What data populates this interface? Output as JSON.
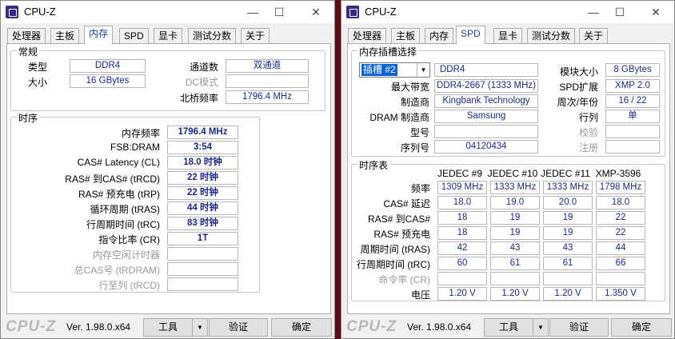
{
  "left_window": {
    "title": "CPU-Z",
    "tabs": [
      "处理器",
      "主板",
      "内存",
      "SPD",
      "显卡",
      "测试分数",
      "关于"
    ],
    "general": {
      "title": "常规",
      "type_label": "类型",
      "type_value": "DDR4",
      "size_label": "大小",
      "size_value": "16 GBytes",
      "channels_label": "通道数",
      "channels_value": "双通道",
      "dc_mode_label": "DC模式",
      "dc_mode_value": "",
      "nb_freq_label": "北桥频率",
      "nb_freq_value": "1796.4 MHz"
    },
    "timings": {
      "title": "时序",
      "rows": [
        {
          "label": "内存频率",
          "value": "1796.4 MHz",
          "dim": false
        },
        {
          "label": "FSB:DRAM",
          "value": "3:54",
          "dim": false
        },
        {
          "label": "CAS# Latency (CL)",
          "value": "18.0 时钟",
          "dim": false
        },
        {
          "label": "RAS# 到CAS# (tRCD)",
          "value": "22 时钟",
          "dim": false
        },
        {
          "label": "RAS# 预充电 (tRP)",
          "value": "22 时钟",
          "dim": false
        },
        {
          "label": "循环周期 (tRAS)",
          "value": "44 时钟",
          "dim": false
        },
        {
          "label": "行周期时间 (tRC)",
          "value": "83 时钟",
          "dim": false
        },
        {
          "label": "指令比率 (CR)",
          "value": "1T",
          "dim": false
        },
        {
          "label": "内存空闲计时器",
          "value": "",
          "dim": true
        },
        {
          "label": "总CAS号 (tRDRAM)",
          "value": "",
          "dim": true
        },
        {
          "label": "行至列 (tRCD)",
          "value": "",
          "dim": true
        }
      ]
    },
    "footer": {
      "logo": "CPU-Z",
      "version": "Ver. 1.98.0.x64",
      "tools": "工具",
      "validate": "验证",
      "ok": "确定"
    }
  },
  "right_window": {
    "title": "CPU-Z",
    "tabs": [
      "处理器",
      "主板",
      "内存",
      "SPD",
      "显卡",
      "测试分数",
      "关于"
    ],
    "slot": {
      "title": "内存插槽选择",
      "selected_slot": "插槽 #2",
      "type_value": "DDR4",
      "module_size_label": "模块大小",
      "module_size_value": "8 GBytes",
      "max_bw_label": "最大带宽",
      "max_bw_value": "DDR4-2667 (1333 MHz)",
      "spd_ext_label": "SPD扩展",
      "spd_ext_value": "XMP 2.0",
      "manufacturer_label": "制造商",
      "manufacturer_value": "Kingbank Technology",
      "week_year_label": "周次/年份",
      "week_year_value": "16 / 22",
      "dram_mfr_label": "DRAM 制造商",
      "dram_mfr_value": "Samsung",
      "ranks_label": "行列",
      "ranks_value": "单",
      "part_label": "型号",
      "part_value": "",
      "verify_label": "校验",
      "verify_value": "",
      "serial_label": "序列号",
      "serial_value": "04120434",
      "registered_label": "注册",
      "registered_value": ""
    },
    "timing_table": {
      "title": "时序表",
      "columns": [
        "JEDEC #9",
        "JEDEC #10",
        "JEDEC #11",
        "XMP-3596"
      ],
      "rows": [
        {
          "label": "频率",
          "values": [
            "1309 MHz",
            "1333 MHz",
            "1333 MHz",
            "1798 MHz"
          ],
          "dim": false
        },
        {
          "label": "CAS# 延迟",
          "values": [
            "18.0",
            "19.0",
            "20.0",
            "18.0"
          ],
          "dim": false
        },
        {
          "label": "RAS# 到CAS#",
          "values": [
            "18",
            "19",
            "19",
            "22"
          ],
          "dim": false
        },
        {
          "label": "RAS# 预充电",
          "values": [
            "18",
            "19",
            "19",
            "22"
          ],
          "dim": false
        },
        {
          "label": "周期时间 (tRAS)",
          "values": [
            "42",
            "43",
            "43",
            "44"
          ],
          "dim": false
        },
        {
          "label": "行周期时间 (tRC)",
          "values": [
            "60",
            "61",
            "61",
            "66"
          ],
          "dim": false
        },
        {
          "label": "命令率 (CR)",
          "values": [
            "",
            "",
            "",
            ""
          ],
          "dim": true
        },
        {
          "label": "电压",
          "values": [
            "1.20 V",
            "1.20 V",
            "1.20 V",
            "1.350 V"
          ],
          "dim": false
        }
      ]
    },
    "footer": {
      "logo": "CPU-Z",
      "version": "Ver. 1.98.0.x64",
      "tools": "工具",
      "validate": "验证",
      "ok": "确定"
    }
  }
}
